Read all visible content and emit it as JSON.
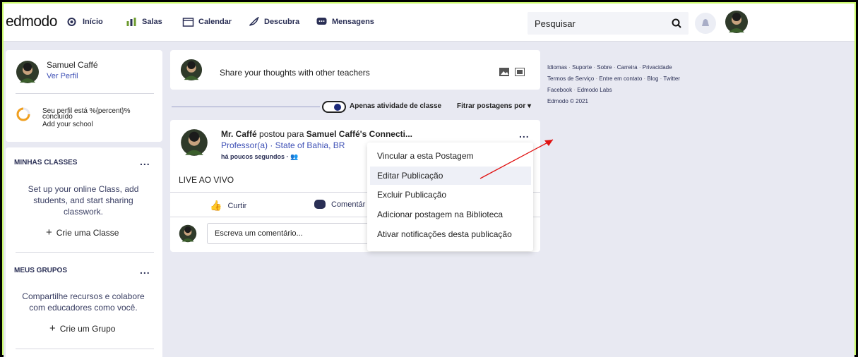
{
  "app": {
    "logo": "edmodo",
    "accent": "#2a2f55",
    "link_color": "#3d4fb5",
    "frame_color": "#c9f76a"
  },
  "nav": {
    "items": [
      {
        "label": "Início",
        "icon": "home-icon"
      },
      {
        "label": "Salas",
        "icon": "classes-icon"
      },
      {
        "label": "Calendar",
        "icon": "calendar-icon"
      },
      {
        "label": "Descubra",
        "icon": "rocket-icon"
      },
      {
        "label": "Mensagens",
        "icon": "messages-icon"
      }
    ],
    "search_placeholder": "Pesquisar"
  },
  "profile": {
    "name": "Samuel Caffé",
    "link": "Ver Perfil",
    "progress_text": "Seu perfil está %{percent}% concluído",
    "progress_line1": "Seu perfil está %{percent}%",
    "progress_line2": "concluído",
    "add_school": "Add your school"
  },
  "classes": {
    "title": "MINHAS CLASSES",
    "menu": "...",
    "description_line1": "Set up your online Class, add",
    "description_line2": "students, and start sharing",
    "description_line3": "classwork.",
    "create": "Crie uma Classe"
  },
  "groups": {
    "title": "MEUS GRUPOS",
    "menu": "...",
    "description_line1": "Compartilhe recursos e colabore",
    "description_line2": "com educadores como você.",
    "create": "Crie um Grupo"
  },
  "share": {
    "text": "Share your thoughts with other teachers"
  },
  "filter": {
    "toggle_label": "Apenas atividade de classe",
    "filter_label": "Fitrar postagens por"
  },
  "post": {
    "author": "Mr. Caffé",
    "verb": "postou para",
    "target": "Samuel Caffé's Connecti...",
    "role": "Professor(a) · State of Bahia, BR",
    "time": "há poucos segundos ·",
    "content": "LIVE AO VIVO",
    "like": "Curtir",
    "comment": "Comentár",
    "comment_placeholder": "Escreva um comentário...",
    "menu_dots": "..."
  },
  "post_menu": {
    "items": [
      "Vincular a esta Postagem",
      "Editar Publicação",
      "Excluir Publicação",
      "Adicionar postagem na Biblioteca",
      "Ativar notificações desta publicação"
    ]
  },
  "footer": {
    "line1": [
      "Idiomas",
      "Suporte",
      "Sobre",
      "Carreira",
      "Privacidade"
    ],
    "line2": [
      "Termos de Serviço",
      "Entre em contato",
      "Blog",
      "Twitter"
    ],
    "line3": [
      "Facebook",
      "Edmodo Labs"
    ],
    "copyright": "Edmodo © 2021"
  }
}
